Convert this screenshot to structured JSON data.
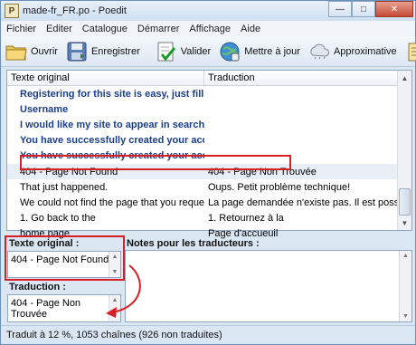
{
  "window": {
    "title": "made-fr_FR.po - Poedit",
    "app_icon_glyph": "P"
  },
  "menu": [
    "Fichier",
    "Editer",
    "Catalogue",
    "Démarrer",
    "Affichage",
    "Aide"
  ],
  "toolbar": {
    "open_label": "Ouvrir",
    "save_label": "Enregistrer",
    "validate_label": "Valider",
    "update_label": "Mettre à jour",
    "fuzzy_label": "Approximative"
  },
  "list": {
    "col_original": "Texte original",
    "col_translation": "Traduction",
    "rows": [
      {
        "original": "Registering for this site is easy, just fill in ...",
        "translation": "",
        "untranslated": true
      },
      {
        "original": "Username",
        "translation": "",
        "untranslated": true
      },
      {
        "original": "I would like my site to appear in search e...",
        "translation": "",
        "untranslated": true
      },
      {
        "original": "You have successfully created your accou...",
        "translation": "",
        "untranslated": true
      },
      {
        "original": "You have successfully created your accou...",
        "translation": "",
        "untranslated": true
      },
      {
        "original": "404 - Page Not Found",
        "translation": "404 - Page Non Trouvée",
        "untranslated": false,
        "selected": true
      },
      {
        "original": "That just happened.",
        "translation": "Oups. Petit problème technique!",
        "untranslated": false
      },
      {
        "original": "We could not find the page that you reques...",
        "translation": "La page demandée n'existe pas. Il est possible...",
        "untranslated": false
      },
      {
        "original": "1. Go back to the",
        "translation": "1. Retournez à la",
        "untranslated": false
      },
      {
        "original": "home page",
        "translation": "Page d'accueuil",
        "untranslated": false
      }
    ]
  },
  "panes": {
    "original_label": "Texte original :",
    "original_value": "404 - Page Not Found",
    "notes_label": "Notes pour les traducteurs :",
    "translation_label": "Traduction :",
    "translation_value": "404 - Page Non Trouvée"
  },
  "status": "Traduit à 12 %, 1053 chaînes (926 non traduites)",
  "colors": {
    "highlight_red": "#d81f26",
    "untranslated_blue": "#1a3e8a"
  }
}
